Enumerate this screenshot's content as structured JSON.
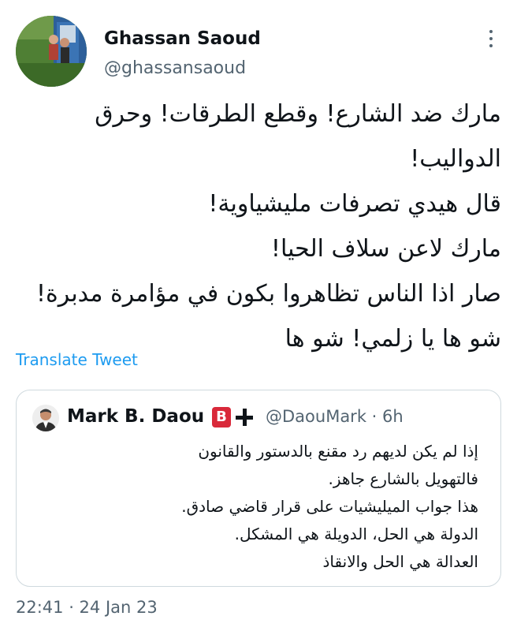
{
  "tweet": {
    "author_name": "Ghassan Saoud",
    "author_handle": "@ghassansaoud",
    "text_lines": [
      "مارك ضد الشارع! وقطع الطرقات! وحرق",
      "الدواليب!",
      "قال هيدي تصرفات مليشياوية!",
      "مارك لاعن سلاف الحيا!",
      "صار اذا الناس تظاهروا بكون في مؤامرة مدبرة!",
      "شو ها يا زلمي! شو ها"
    ],
    "translate_label": "Translate Tweet",
    "timestamp": "22:41 · 24 Jan 23",
    "more_icon": "more-vertical-icon"
  },
  "quoted": {
    "author_name": "Mark B. Daou",
    "badge_letter": "B",
    "badge_color": "#d9293a",
    "plus_icon": "plus-icon",
    "meta": "@DaouMark · 6h",
    "text_lines": [
      "إذا لم يكن لديهم رد مقنع بالدستور والقانون",
      "فالتهويل بالشارع جاهز.",
      "هذا جواب الميليشيات على قرار قاضي صادق.",
      "الدولة هي الحل، الدويلة هي المشكل.",
      "العدالة هي الحل والانقاذ"
    ]
  },
  "colors": {
    "link": "#1d9bf0",
    "secondary_text": "#536471",
    "border": "#cfd9de"
  }
}
